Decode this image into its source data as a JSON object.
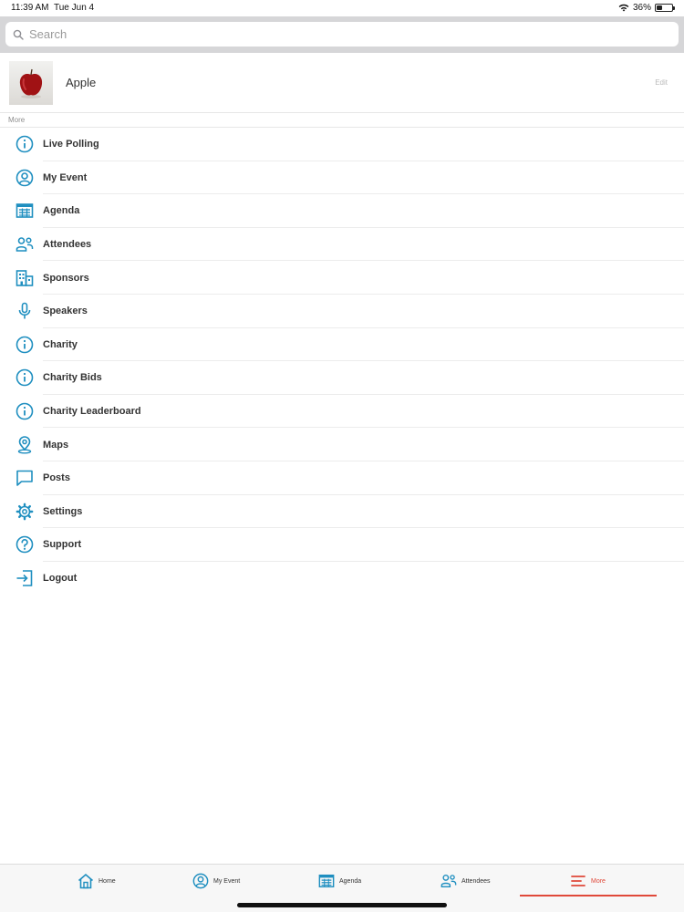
{
  "status_bar": {
    "time": "11:39 AM",
    "date": "Tue Jun 4",
    "battery": "36%",
    "battery_level": 0.36
  },
  "search": {
    "placeholder": "Search",
    "value": ""
  },
  "profile": {
    "name": "Apple",
    "edit_label": "Edit"
  },
  "section": {
    "title": "More"
  },
  "menu": {
    "items": [
      {
        "label": "Live Polling",
        "icon": "info-icon"
      },
      {
        "label": "My Event",
        "icon": "user-circle-icon"
      },
      {
        "label": "Agenda",
        "icon": "calendar-grid-icon"
      },
      {
        "label": "Attendees",
        "icon": "people-icon"
      },
      {
        "label": "Sponsors",
        "icon": "building-icon"
      },
      {
        "label": "Speakers",
        "icon": "microphone-icon"
      },
      {
        "label": "Charity",
        "icon": "info-icon"
      },
      {
        "label": "Charity Bids",
        "icon": "info-icon"
      },
      {
        "label": "Charity Leaderboard",
        "icon": "info-icon"
      },
      {
        "label": "Maps",
        "icon": "map-pin-icon"
      },
      {
        "label": "Posts",
        "icon": "chat-bubble-icon"
      },
      {
        "label": "Settings",
        "icon": "gear-icon"
      },
      {
        "label": "Support",
        "icon": "help-circle-icon"
      },
      {
        "label": "Logout",
        "icon": "logout-icon"
      }
    ]
  },
  "tab_bar": {
    "tabs": [
      {
        "label": "Home",
        "icon": "home-icon"
      },
      {
        "label": "My Event",
        "icon": "user-circle-icon"
      },
      {
        "label": "Agenda",
        "icon": "calendar-grid-icon"
      },
      {
        "label": "Attendees",
        "icon": "people-icon"
      },
      {
        "label": "More",
        "icon": "menu-lines-icon",
        "active": true
      }
    ]
  },
  "colors": {
    "icon": "#1f8fc0",
    "accent": "#e0493a",
    "text": "#333333"
  }
}
